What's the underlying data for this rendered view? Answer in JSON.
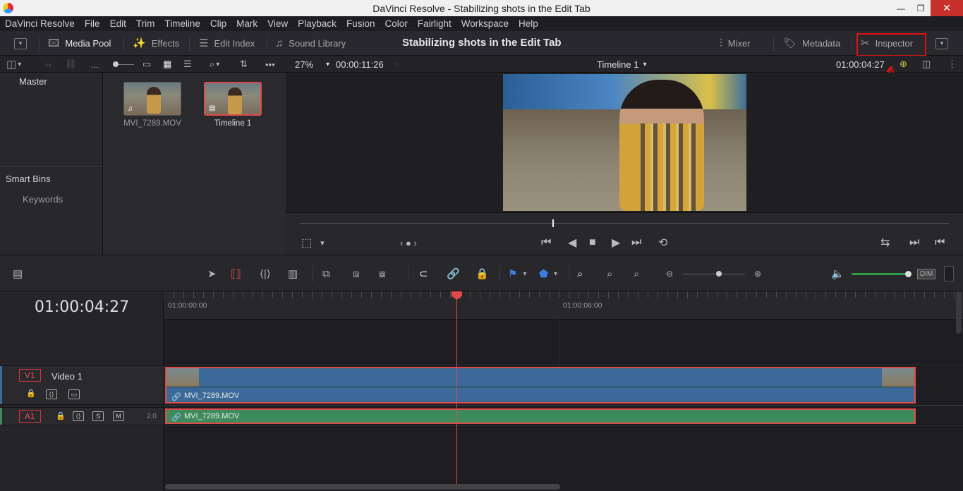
{
  "window": {
    "title": "DaVinci Resolve - Stabilizing shots in the Edit Tab",
    "minimize": "—",
    "maximize": "❐",
    "close": "✕"
  },
  "menu": [
    "DaVinci Resolve",
    "File",
    "Edit",
    "Trim",
    "Timeline",
    "Clip",
    "Mark",
    "View",
    "Playback",
    "Fusion",
    "Color",
    "Fairlight",
    "Workspace",
    "Help"
  ],
  "toolbar": {
    "media_pool": "Media Pool",
    "effects": "Effects",
    "edit_index": "Edit Index",
    "sound_library": "Sound Library",
    "page_title": "Stabilizing shots in the Edit Tab",
    "mixer": "Mixer",
    "metadata": "Metadata",
    "inspector": "Inspector"
  },
  "subbar": {
    "dots": "...",
    "zoom": "27%",
    "source_tc": "00:00:11:26",
    "timeline_name": "Timeline 1",
    "timeline_tc": "01:00:04:27"
  },
  "bins": {
    "master": "Master",
    "smart_bins": "Smart Bins",
    "keywords": "Keywords"
  },
  "media_pool": {
    "clips": [
      {
        "name": "MVI_7289.MOV"
      },
      {
        "name": "Timeline 1"
      }
    ]
  },
  "timeline": {
    "timecode": "01:00:04:27",
    "ruler": [
      "01:00:00:00",
      "01:00:06:00"
    ],
    "video_track": {
      "tag": "V1",
      "name": "Video 1",
      "clip": "MVI_7289.MOV"
    },
    "audio_track": {
      "tag": "A1",
      "solo": "S",
      "mute": "M",
      "channels": "2.0",
      "clip": "MVI_7289.MOV"
    },
    "dim": "DIM"
  },
  "colors": {
    "accent_red": "#e04a4a",
    "video_clip": "#3b6a98",
    "audio_clip": "#3d8a5c",
    "volume": "#2ea043"
  }
}
